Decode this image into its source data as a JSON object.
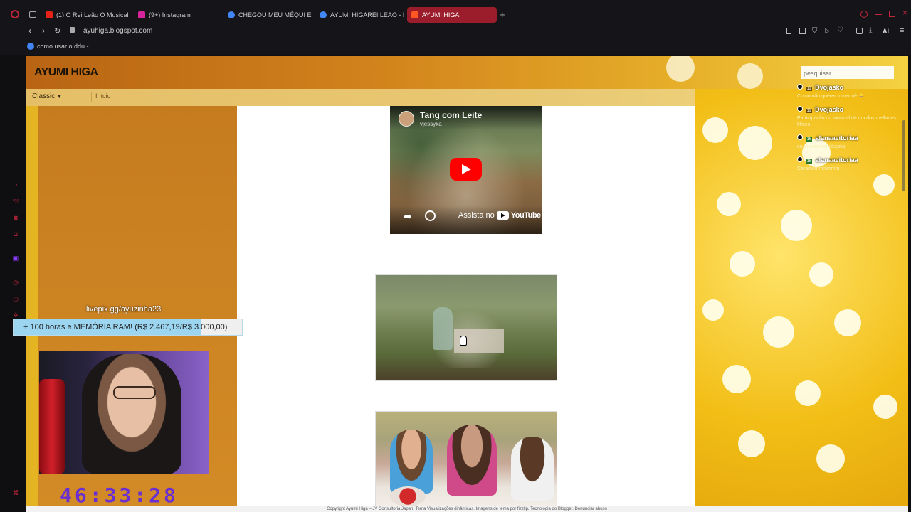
{
  "browser": {
    "tabs": [
      {
        "label": "(1) O Rei Leão O Musical - ",
        "icon": "youtube-icon",
        "color": "#e62117"
      },
      {
        "label": "(9+) Instagram",
        "icon": "instagram-icon",
        "color": "#d6249f"
      },
      {
        "label": "CHEGOU MEU MÉQUI E P(",
        "icon": "google-icon",
        "color": "#4285f4"
      },
      {
        "label": "AYUMI HIGAREI LEAO - Pe",
        "icon": "google-icon",
        "color": "#4285f4"
      },
      {
        "label": "AYUMI HIGA",
        "icon": "blogger-icon",
        "color": "#ff5722"
      }
    ],
    "url": "ayuhiga.blogspot.com",
    "bookmark": "como usar o ddu -...",
    "ai_label": "AI"
  },
  "blog": {
    "title": "AYUMI HIGA",
    "view_select": "Classic",
    "nav_home": "Início",
    "search_placeholder": "pesquisar"
  },
  "video": {
    "title": "Tang com Leite",
    "channel": "vjessyka",
    "watch_on": "Assista no",
    "platform": "YouTube"
  },
  "overlay": {
    "livepix": "livepix.gg/ayuzinha23",
    "goal": "+ 100 horas e MEMÓRIA RAM! (R$ 2.467,19/R$ 3.000,00)",
    "goal_progress": 0.822,
    "timer": "46:33:28"
  },
  "chat": [
    {
      "user": "Dvojasko",
      "badge": "11",
      "message": "Como não querer tomar né 😄"
    },
    {
      "user": "Dvojasko",
      "badge": "11",
      "message": "Participação do musical de um dos melhores filmes"
    },
    {
      "user": "alanaavitoriaa",
      "badge": "16",
      "message": "eu já entrei aí aksjsks"
    },
    {
      "user": "alanaavitoriaa",
      "badge": "16",
      "message": "Caramsmmmmmm"
    }
  ],
  "footer": {
    "text": "Copyright Ayumi Higa – JV Consultoria Japan. Tema Visualizações dinâmicas. Imagens de tema por fizzlip. Tecnologia do Blogger. Denunciar abuso"
  },
  "colors": {
    "accent": "#9b1d2c",
    "header_gold": "#e7b02a",
    "goal_fill": "#9bd5f0",
    "timer_purple": "#6a2fd1"
  }
}
